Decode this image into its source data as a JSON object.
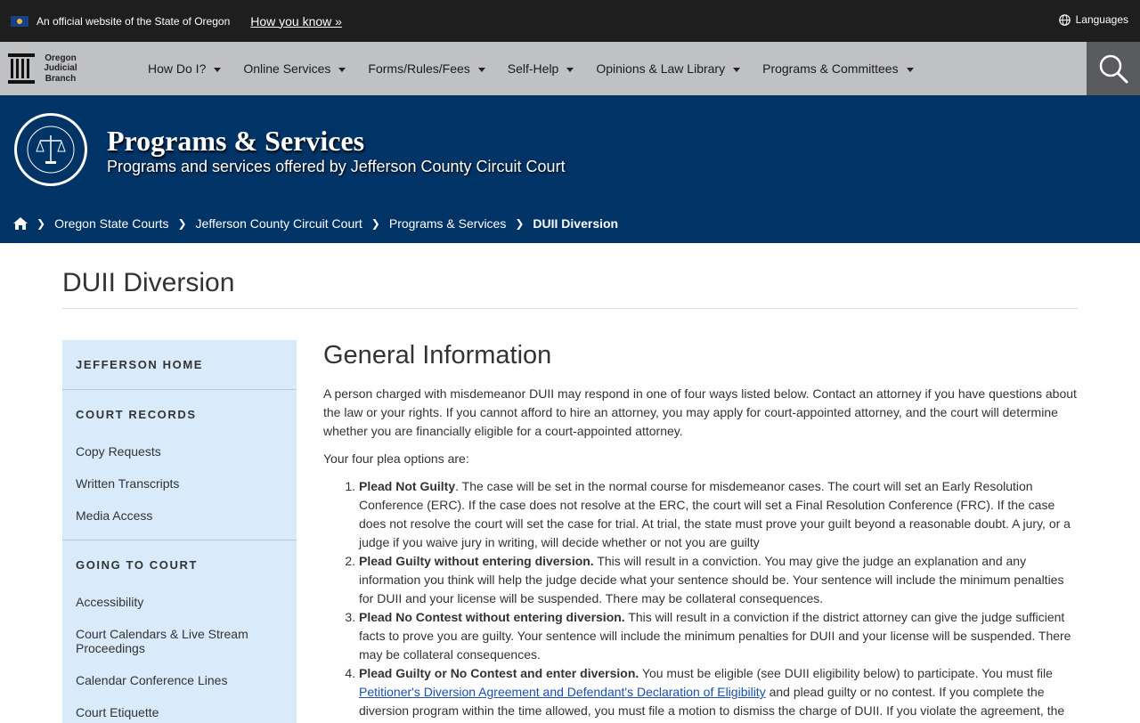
{
  "official_banner": {
    "text": "An official website of the State of Oregon",
    "how_you_know": "How you know »",
    "languages": "Languages"
  },
  "logo": {
    "line1": "Oregon",
    "line2": "Judicial",
    "line3": "Branch"
  },
  "nav": {
    "items": [
      {
        "label": "How Do I?"
      },
      {
        "label": "Online Services"
      },
      {
        "label": "Forms/Rules/Fees"
      },
      {
        "label": "Self-Help"
      },
      {
        "label": "Opinions & Law Library"
      },
      {
        "label": "Programs & Committees"
      }
    ]
  },
  "hero": {
    "title": "Programs & Services",
    "subtitle": "Programs and services offered by Jefferson County Circuit Court"
  },
  "breadcrumb": {
    "items": [
      "Oregon State Courts",
      "Jefferson County Circuit Court",
      "Programs & Services"
    ],
    "current": "DUII Diversion"
  },
  "page": {
    "title": "DUII Diversion"
  },
  "sidebar": {
    "home": "JEFFERSON HOME",
    "sections": [
      {
        "heading": "COURT RECORDS",
        "links": [
          "Copy Requests",
          "Written Transcripts",
          "Media Access"
        ]
      },
      {
        "heading": "GOING TO COURT",
        "links": [
          "Accessibility",
          "Court Calendars & Live Stream Proceedings",
          "Calendar Conference Lines",
          "Court Etiquette"
        ]
      }
    ]
  },
  "content": {
    "heading": "General Information",
    "intro": "A person charged with misdemeanor DUII may respond in one of four ways listed below. Contact an attorney if you have questions about the law or your rights. If you cannot afford to hire an attorney, you may apply for court-appointed attorney, and the court will determine whether you are financially eligible for a court-appointed attorney.",
    "plea_intro": "Your four plea options are:",
    "options": [
      {
        "bold": "Plead Not Guilty",
        "text": ". The case will be set in the normal course for misdemeanor cases. The court will set an Early Resolution Conference (ERC). If the case does not resolve at the ERC, the court will set a Final Resolution Conference (FRC). If the case does not resolve the court will set the case for trial. At trial, the state must prove your guilt beyond a reasonable doubt. A jury, or a judge if you waive jury in writing, will decide whether or not you are guilty"
      },
      {
        "bold": "Plead Guilty without entering diversion.",
        "text": " This will result in a conviction. You may give the judge an explanation and any information you think will help the judge decide what your sentence should be. Your sentence will include the minimum penalties for DUII and your license will be suspended. There may be collateral consequences."
      },
      {
        "bold": "Plead No Contest without entering diversion.",
        "text": " This will result in a conviction if the district attorney can give the judge sufficient facts to prove you are guilty. Your sentence will include the minimum penalties for DUII and your license will be suspended. There may be collateral consequences."
      },
      {
        "bold": "Plead Guilty or No Contest and enter diversion.",
        "text": " You must be eligible (see DUII eligibility below) to participate. You must file ",
        "link": "Petitioner's Diversion Agreement and Defendant's Declaration of Eligibility",
        "text2": " and plead guilty or no contest. If you complete the diversion program within the time allowed, you must file a motion to dismiss the charge of DUII. If you violate the agreement, the"
      }
    ]
  }
}
